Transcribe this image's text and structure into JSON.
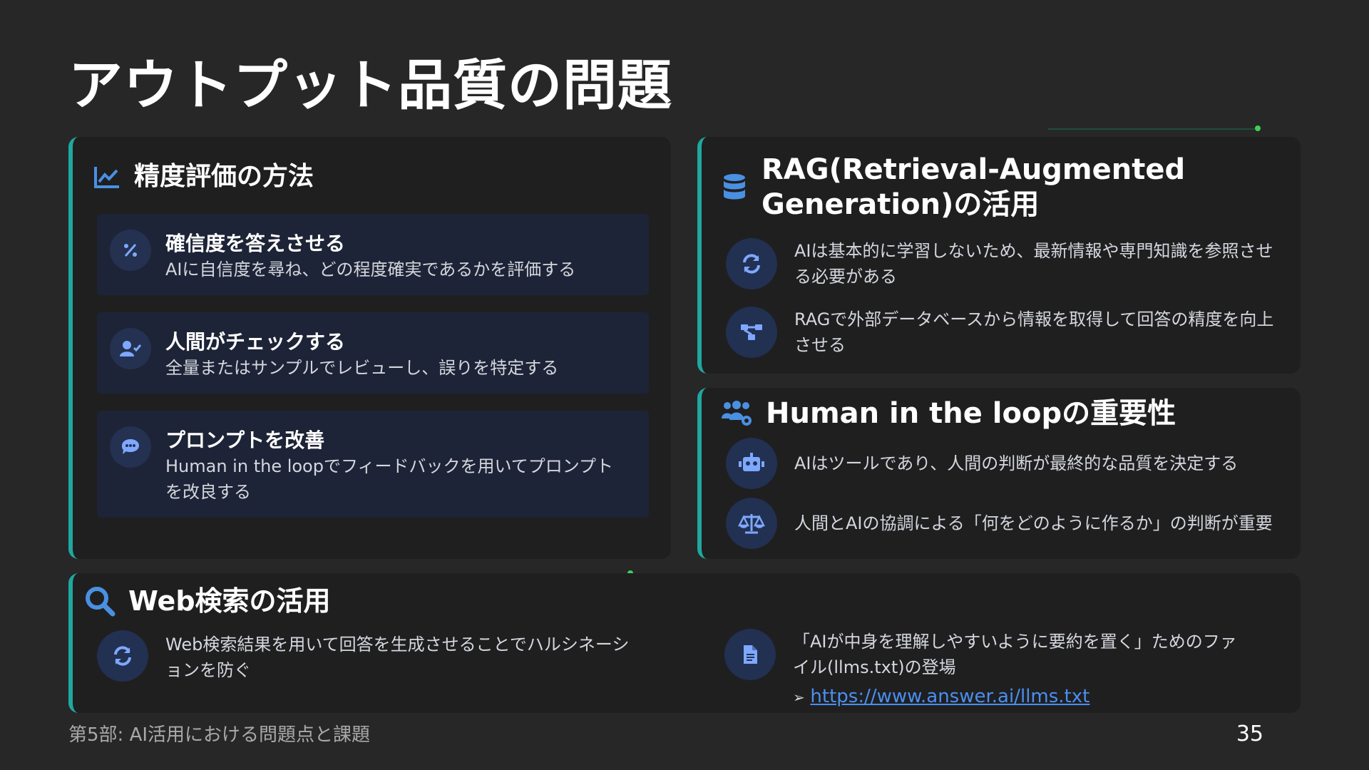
{
  "title": "アウトプット品質の問題",
  "accuracy": {
    "heading": "精度評価の方法",
    "items": [
      {
        "title": "確信度を答えさせる",
        "desc": "AIに自信度を尋ね、どの程度確実であるかを評価する",
        "icon": "percent-icon"
      },
      {
        "title": "人間がチェックする",
        "desc": "全量またはサンプルでレビューし、誤りを特定する",
        "icon": "user-check-icon"
      },
      {
        "title": "プロンプトを改善",
        "desc": "Human in the loopでフィードバックを用いてプロンプトを改良する",
        "icon": "chat-bubble-icon"
      }
    ]
  },
  "rag": {
    "heading": "RAG(Retrieval-Augmented Generation)の活用",
    "rows": [
      {
        "text": "AIは基本的に学習しないため、最新情報や専門知識を参照させる必要がある",
        "icon": "sync-icon"
      },
      {
        "text": "RAGで外部データベースから情報を取得して回答の精度を向上させる",
        "icon": "network-icon"
      }
    ]
  },
  "hitl": {
    "heading": "Human in the loopの重要性",
    "rows": [
      {
        "text": "AIはツールであり、人間の判断が最終的な品質を決定する",
        "icon": "robot-icon"
      },
      {
        "text": "人間とAIの協調による「何をどのように作るか」の判断が重要",
        "icon": "scale-icon"
      }
    ]
  },
  "web": {
    "heading": "Web検索の活用",
    "left_text": "Web検索結果を用いて回答を生成させることでハルシネーションを防ぐ",
    "right_text": "「AIが中身を理解しやすいように要約を置く」ためのファイル(llms.txt)の登場",
    "bullet": "➢",
    "link": "https://www.answer.ai/llms.txt"
  },
  "footer": "第5部: AI活用における問題点と課題",
  "page_number": "35",
  "colors": {
    "accent": "#1fa7a0",
    "icon_blue": "#4a90e2",
    "item_bg": "#1e2437"
  }
}
